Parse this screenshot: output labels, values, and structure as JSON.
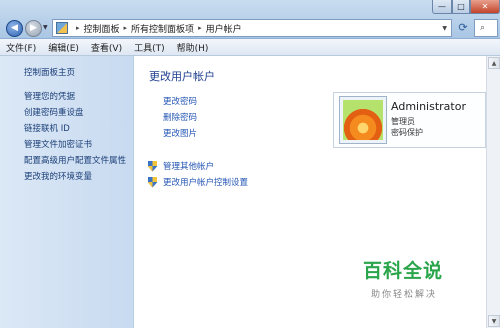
{
  "address_bar": {
    "crumbs": [
      "控制面板",
      "所有控制面板项",
      "用户帐户"
    ],
    "separator": "▸"
  },
  "window_controls": {
    "minimize": "—",
    "maximize": "□",
    "close": "✕"
  },
  "menu": [
    "文件(F)",
    "编辑(E)",
    "查看(V)",
    "工具(T)",
    "帮助(H)"
  ],
  "sidebar": {
    "home": "控制面板主页",
    "items": [
      "管理您的凭据",
      "创建密码重设盘",
      "链接联机 ID",
      "管理文件加密证书",
      "配置高级用户配置文件属性",
      "更改我的环境变量"
    ]
  },
  "main": {
    "heading": "更改用户帐户",
    "links": [
      "更改密码",
      "删除密码",
      "更改图片"
    ],
    "shield_links": [
      "管理其他帐户",
      "更改用户帐户控制设置"
    ]
  },
  "account": {
    "name": "Administrator",
    "role": "管理员",
    "password_status": "密码保护"
  },
  "watermark": {
    "title": "百科全说",
    "subtitle": "助你轻松解决"
  },
  "colors": {
    "link": "#2456b4",
    "sidebar_bg": "#c8daf0",
    "heading": "#1e3f8f"
  }
}
